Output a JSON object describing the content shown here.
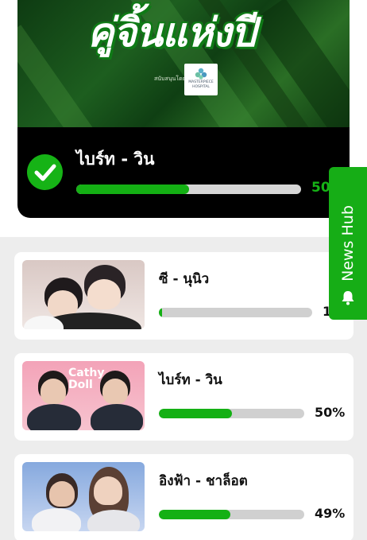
{
  "hero": {
    "banner_title": "คู่จิ้นแห่งปี",
    "sponsor_caption": "สนับสนุนโดย",
    "sponsor_logo_text": "MASTERPIECE",
    "sponsor_logo_sub": "HOSPITAL",
    "winner_name": "ไบร์ท - วิน",
    "winner_percent": "50%",
    "winner_progress": 0.5
  },
  "side_tab": {
    "label": "News Hub"
  },
  "candidates": [
    {
      "name": "ซี - นุนิว",
      "percent": "1",
      "progress": 0.01
    },
    {
      "name": "ไบร์ท - วิน",
      "percent": "50%",
      "progress": 0.5,
      "thumb_text": "Cathy Doll"
    },
    {
      "name": "อิงฟ้า - ชาล็อต",
      "percent": "49%",
      "progress": 0.49
    }
  ],
  "colors": {
    "accent": "#16b316",
    "bar_bg": "#d0d0d0"
  }
}
